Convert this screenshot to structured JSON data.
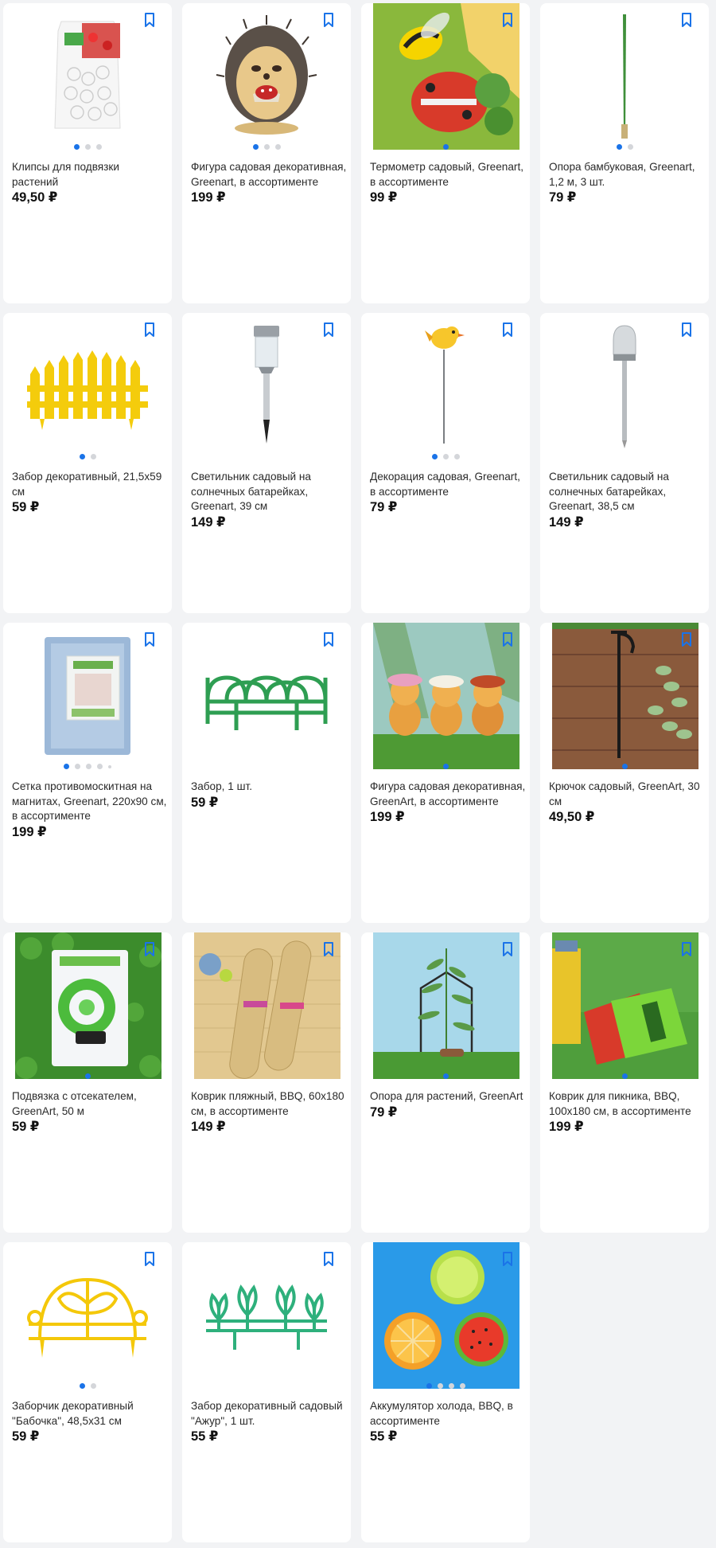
{
  "currency": "₽",
  "products": [
    {
      "title": "Клипсы для подвязки растений",
      "price": "49,50 ₽",
      "image": "white-clips-bag",
      "dots": 3,
      "active_dot": 0
    },
    {
      "title": "Фигура садовая декоративная, Greenart, в ассортименте",
      "price": "199 ₽",
      "image": "hedgehog-figure",
      "dots": 3,
      "active_dot": 0
    },
    {
      "title": "Термометр садовый, Greenart, в ассортименте",
      "price": "99 ₽",
      "image": "bee-ladybug-thermometer",
      "dots": 1,
      "active_dot": 0
    },
    {
      "title": "Опора бамбуковая, Greenart, 1,2 м, 3 шт.",
      "price": "79 ₽",
      "image": "bamboo-stick",
      "dots": 2,
      "active_dot": 0
    },
    {
      "title": "Забор декоративный, 21,5х59 см",
      "price": "59 ₽",
      "image": "yellow-fence",
      "dots": 2,
      "active_dot": 0
    },
    {
      "title": "Светильник садовый на солнечных батарейках, Greenart, 39 см",
      "price": "149 ₽",
      "image": "solar-lamp-square",
      "dots": 0,
      "active_dot": -1
    },
    {
      "title": "Декорация садовая, Greenart, в ассортименте",
      "price": "79 ₽",
      "image": "bird-stake",
      "dots": 3,
      "active_dot": 0
    },
    {
      "title": "Светильник садовый на солнечных батарейках, Greenart, 38,5 см",
      "price": "149 ₽",
      "image": "solar-lamp-round",
      "dots": 0,
      "active_dot": -1
    },
    {
      "title": "Сетка противомоскитная на магнитах, Greenart, 220х90 см, в ассортименте",
      "price": "199 ₽",
      "image": "mosquito-net-pack",
      "dots": 5,
      "active_dot": 0
    },
    {
      "title": "Забор, 1 шт.",
      "price": "59 ₽",
      "image": "green-arch-fence",
      "dots": 0,
      "active_dot": -1
    },
    {
      "title": "Фигура садовая декоративная, GreenArt, в ассортименте",
      "price": "199 ₽",
      "image": "hamster-figures",
      "dots": 1,
      "active_dot": 0
    },
    {
      "title": "Крючок садовый, GreenArt, 30 см",
      "price": "49,50 ₽",
      "image": "garden-hook",
      "dots": 1,
      "active_dot": 0
    },
    {
      "title": "Подвязка с отсекателем, GreenArt, 50 м",
      "price": "59 ₽",
      "image": "green-tie-reel",
      "dots": 1,
      "active_dot": 0
    },
    {
      "title": "Коврик пляжный, BBQ, 60х180 см, в ассортименте",
      "price": "149 ₽",
      "image": "beach-mats",
      "dots": 0,
      "active_dot": -1
    },
    {
      "title": "Опора для растений, GreenArt",
      "price": "79 ₽",
      "image": "plant-support",
      "dots": 1,
      "active_dot": 0
    },
    {
      "title": "Коврик для пикника, BBQ, 100х180 см, в ассортименте",
      "price": "199 ₽",
      "image": "picnic-blanket",
      "dots": 1,
      "active_dot": 0
    },
    {
      "title": "Заборчик декоративный \"Бабочка\", 48,5х31 см",
      "price": "59 ₽",
      "image": "butterfly-fence",
      "dots": 2,
      "active_dot": 0
    },
    {
      "title": "Забор декоративный садовый \"Ажур\", 1 шт.",
      "price": "55 ₽",
      "image": "ajour-fence",
      "dots": 0,
      "active_dot": -1
    },
    {
      "title": "Аккумулятор холода, BBQ, в ассортименте",
      "price": "55 ₽",
      "image": "fruit-ice-packs",
      "dots": 4,
      "active_dot": 0
    }
  ],
  "colors": {
    "accent": "#1a73e8",
    "bookmark": "#1a73e8"
  }
}
